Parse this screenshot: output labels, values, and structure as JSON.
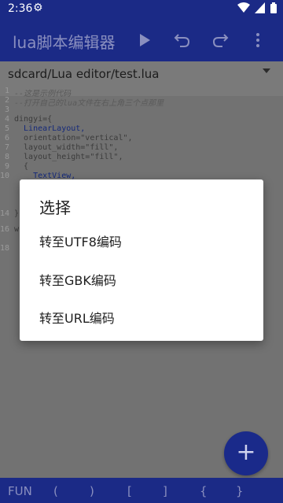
{
  "status": {
    "time": "2:36"
  },
  "toolbar": {
    "title": "lua脚本编辑器"
  },
  "path": "sdcard/Lua editor/test.lua",
  "editor": {
    "lines": [
      {
        "n": "1",
        "text": "--这是示例代码"
      },
      {
        "n": "2",
        "text": "--打开自己的lua文件在右上角三个点那里"
      },
      {
        "n": "3",
        "text": ""
      },
      {
        "n": "4",
        "text": "dingyi={"
      },
      {
        "n": "5",
        "text": "  LinearLayout,"
      },
      {
        "n": "6",
        "text": "  orientation=\"vertical\","
      },
      {
        "n": "7",
        "text": "  layout_width=\"fill\","
      },
      {
        "n": "8",
        "text": "  layout_height=\"fill\","
      },
      {
        "n": "9",
        "text": "  {"
      },
      {
        "n": "10",
        "text": "    TextView,"
      },
      {
        "n": "14",
        "text": "}"
      },
      {
        "n": "16",
        "text": "w"
      },
      {
        "n": "18",
        "text": ""
      }
    ]
  },
  "dialog": {
    "title": "选择",
    "options": [
      "转至UTF8编码",
      "转至GBK编码",
      "转至URL编码"
    ]
  },
  "bottombar": {
    "symbols": [
      "FUN",
      "(",
      ")",
      "[",
      "]",
      "{",
      "}"
    ]
  },
  "fab": {
    "label": "+"
  }
}
